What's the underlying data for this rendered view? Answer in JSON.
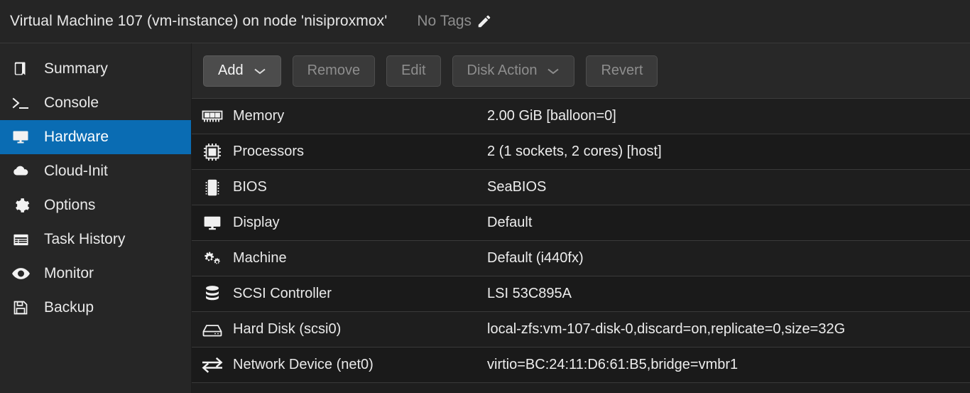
{
  "header": {
    "title": "Virtual Machine 107 (vm-instance) on node 'nisiproxmox'",
    "tags_label": "No Tags",
    "edit_icon": "pencil-icon"
  },
  "sidebar": {
    "items": [
      {
        "label": "Summary",
        "icon": "book-icon",
        "active": false
      },
      {
        "label": "Console",
        "icon": "terminal-icon",
        "active": false
      },
      {
        "label": "Hardware",
        "icon": "monitor-icon",
        "active": true
      },
      {
        "label": "Cloud-Init",
        "icon": "cloud-icon",
        "active": false
      },
      {
        "label": "Options",
        "icon": "gear-icon",
        "active": false
      },
      {
        "label": "Task History",
        "icon": "list-icon",
        "active": false
      },
      {
        "label": "Monitor",
        "icon": "eye-icon",
        "active": false
      },
      {
        "label": "Backup",
        "icon": "floppy-icon",
        "active": false
      }
    ]
  },
  "toolbar": {
    "buttons": [
      {
        "label": "Add",
        "enabled": true,
        "dropdown": true
      },
      {
        "label": "Remove",
        "enabled": false,
        "dropdown": false
      },
      {
        "label": "Edit",
        "enabled": false,
        "dropdown": false
      },
      {
        "label": "Disk Action",
        "enabled": false,
        "dropdown": true
      },
      {
        "label": "Revert",
        "enabled": false,
        "dropdown": false
      }
    ]
  },
  "hardware": {
    "rows": [
      {
        "icon": "memory-icon",
        "key": "Memory",
        "value": "2.00 GiB [balloon=0]"
      },
      {
        "icon": "cpu-icon",
        "key": "Processors",
        "value": "2 (1 sockets, 2 cores) [host]"
      },
      {
        "icon": "chip-icon",
        "key": "BIOS",
        "value": "SeaBIOS"
      },
      {
        "icon": "monitor-icon",
        "key": "Display",
        "value": "Default"
      },
      {
        "icon": "gears-icon",
        "key": "Machine",
        "value": "Default (i440fx)"
      },
      {
        "icon": "database-icon",
        "key": "SCSI Controller",
        "value": "LSI 53C895A"
      },
      {
        "icon": "harddisk-icon",
        "key": "Hard Disk (scsi0)",
        "value": "local-zfs:vm-107-disk-0,discard=on,replicate=0,size=32G"
      },
      {
        "icon": "exchange-icon",
        "key": "Network Device (net0)",
        "value": "virtio=BC:24:11:D6:61:B5,bridge=vmbr1"
      }
    ]
  },
  "colors": {
    "accent": "#0a6cb3",
    "background": "#1e1e1e",
    "sidebar_background": "#262626",
    "header_background": "#252525",
    "text": "#e9e9e9",
    "muted_text": "#8d8d8d"
  }
}
